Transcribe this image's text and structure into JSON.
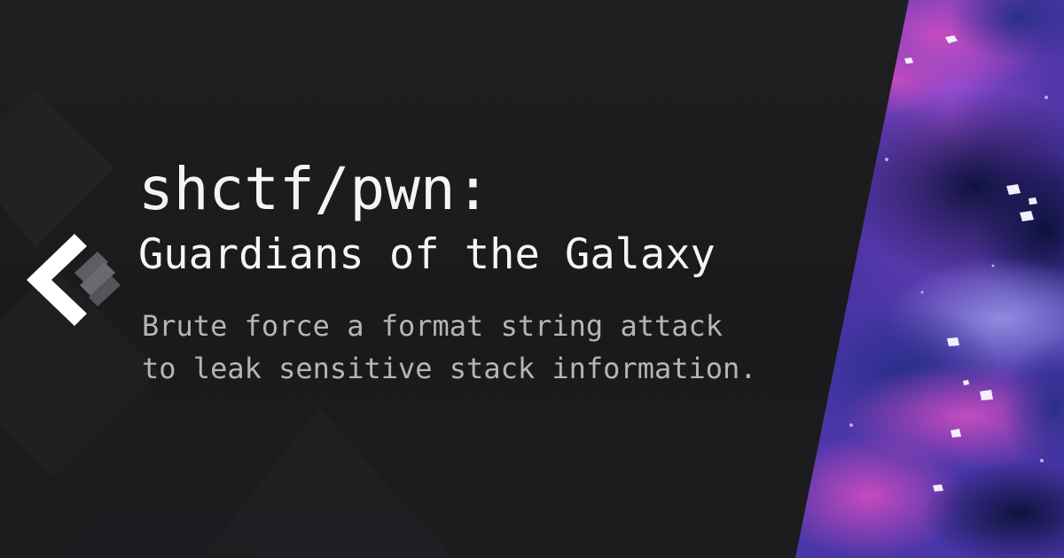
{
  "site": {
    "logo_icon": "chevron-left-brand-icon"
  },
  "post": {
    "title": "shctf/pwn:",
    "subtitle": "Guardians of the Galaxy",
    "description_lines": [
      "Brute force a format string attack",
      "to leak sensitive stack information."
    ]
  },
  "decor": {
    "image": "watercolor-galaxy-nebula",
    "colors": {
      "background": "#1b1b1d",
      "title": "#f4f4f4",
      "description": "#b5b5b8",
      "nebula_purple": "#6b3fc0",
      "nebula_magenta": "#b63fb2",
      "nebula_navy": "#1a1e5c"
    }
  }
}
